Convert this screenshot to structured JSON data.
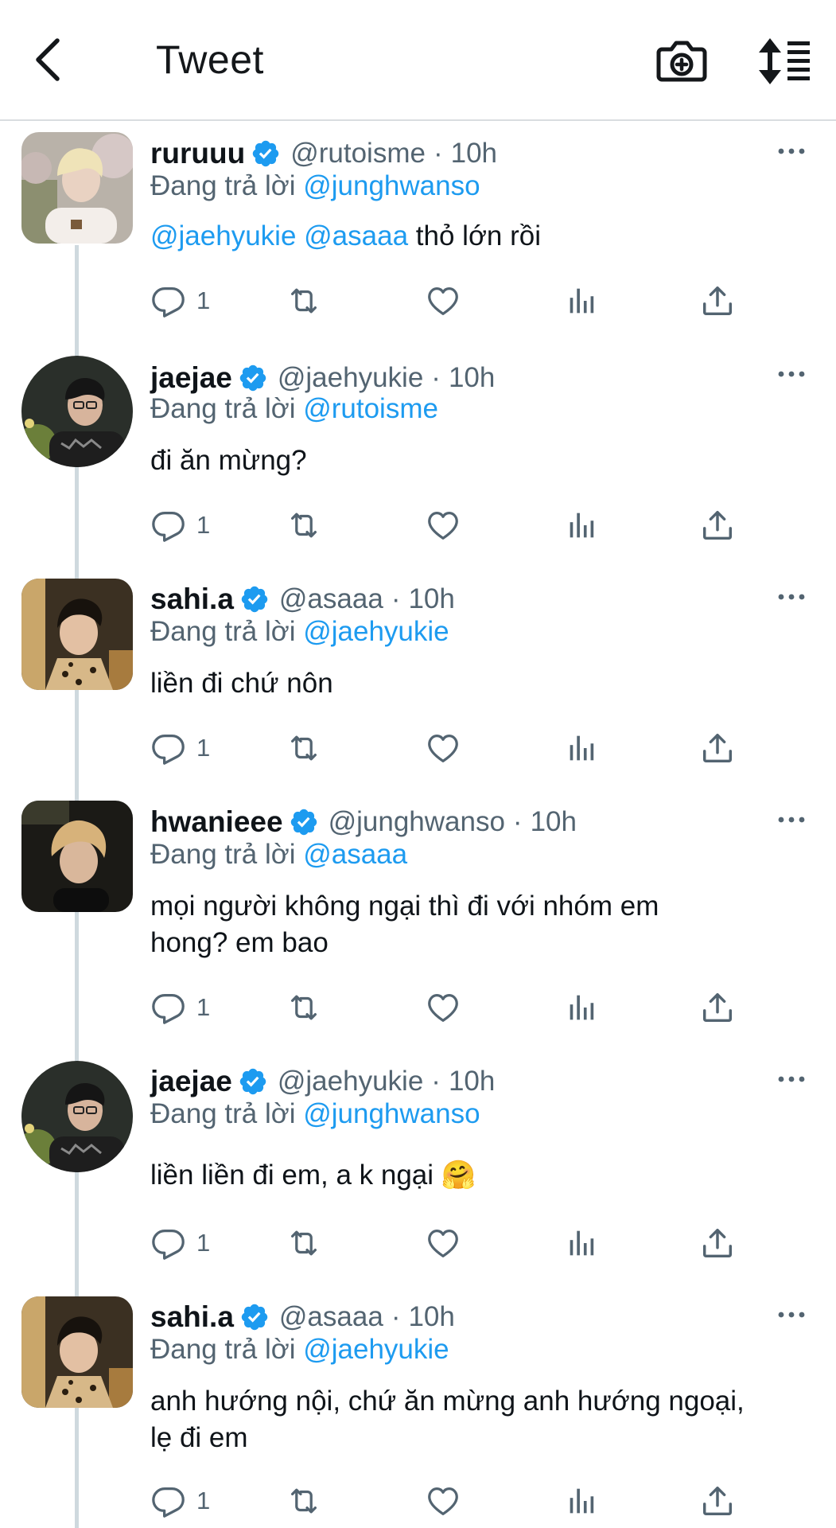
{
  "header": {
    "title": "Tweet"
  },
  "colors": {
    "accent": "#1d9bf0",
    "muted": "#536471",
    "text": "#0f1419",
    "thread_line": "#cfd9de"
  },
  "tweets": [
    {
      "display_name": "ruruuu",
      "handle": "@rutoisme",
      "separator": "·",
      "time": "10h",
      "reply_label": "Đang trả lời",
      "reply_to": "@junghwanso",
      "mentions": [
        "@jaehyukie",
        "@asaaa"
      ],
      "text": "thỏ lớn rồi",
      "reply_count": "1",
      "avatar_icon": "avatar-blonde-hair"
    },
    {
      "display_name": "jaejae",
      "handle": "@jaehyukie",
      "separator": "·",
      "time": "10h",
      "reply_label": "Đang trả lời",
      "reply_to": "@rutoisme",
      "text": "đi ăn mừng?",
      "reply_count": "1",
      "avatar_icon": "avatar-glasses-dark-hair"
    },
    {
      "display_name": "sahi.a",
      "handle": "@asaaa",
      "separator": "·",
      "time": "10h",
      "reply_label": "Đang trả lời",
      "reply_to": "@jaehyukie",
      "text": "liền đi chứ nôn",
      "reply_count": "1",
      "avatar_icon": "avatar-leopard-shirt"
    },
    {
      "display_name": "hwanieee",
      "handle": "@junghwanso",
      "separator": "·",
      "time": "10h",
      "reply_label": "Đang trả lời",
      "reply_to": "@asaaa",
      "text_line1": "mọi người không ngại thì đi với nhóm em",
      "text_line2": "hong? em bao",
      "reply_count": "1",
      "avatar_icon": "avatar-light-hair-dark"
    },
    {
      "display_name": "jaejae",
      "handle": "@jaehyukie",
      "separator": "·",
      "time": "10h",
      "reply_label": "Đang trả lời",
      "reply_to": "@junghwanso",
      "text": "liền liền đi em, a k ngại",
      "emoji": "🤗",
      "reply_count": "1",
      "avatar_icon": "avatar-glasses-dark-hair"
    },
    {
      "display_name": "sahi.a",
      "handle": "@asaaa",
      "separator": "·",
      "time": "10h",
      "reply_label": "Đang trả lời",
      "reply_to": "@jaehyukie",
      "text_line1": "anh hướng nội, chứ ăn mừng anh hướng ngoại,",
      "text_line2": "lẹ đi em",
      "reply_count": "1",
      "avatar_icon": "avatar-leopard-shirt"
    }
  ]
}
